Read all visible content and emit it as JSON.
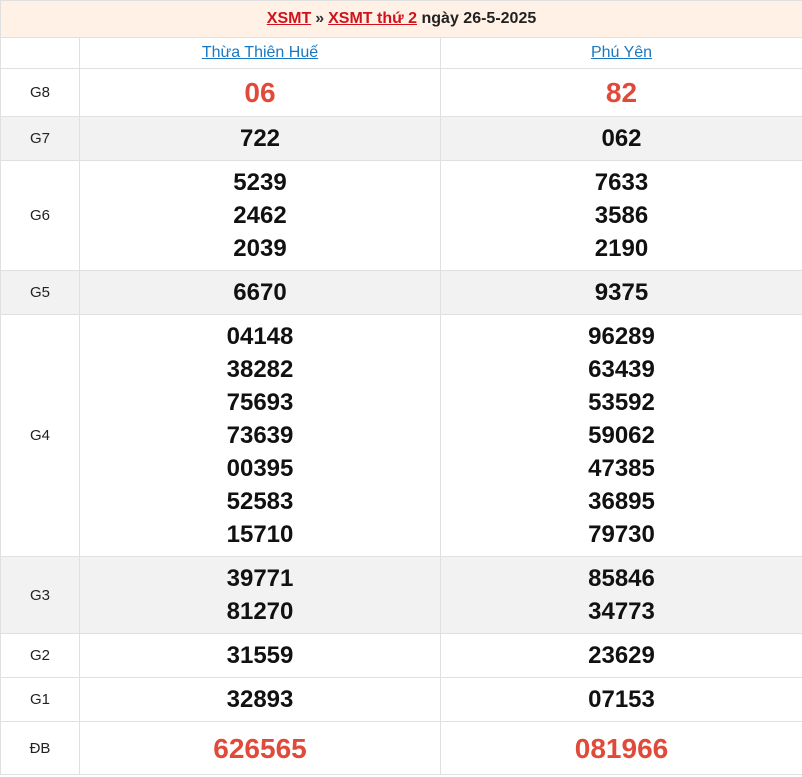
{
  "header": {
    "link1": "XSMT",
    "separator": "»",
    "link2": "XSMT thứ 2",
    "date_text": "ngày 26-5-2025"
  },
  "provinces": [
    "Thừa Thiên Huế",
    "Phú Yên"
  ],
  "prizes": [
    {
      "label": "G8",
      "p1": [
        "06"
      ],
      "p2": [
        "82"
      ]
    },
    {
      "label": "G7",
      "p1": [
        "722"
      ],
      "p2": [
        "062"
      ]
    },
    {
      "label": "G6",
      "p1": [
        "5239",
        "2462",
        "2039"
      ],
      "p2": [
        "7633",
        "3586",
        "2190"
      ]
    },
    {
      "label": "G5",
      "p1": [
        "6670"
      ],
      "p2": [
        "9375"
      ]
    },
    {
      "label": "G4",
      "p1": [
        "04148",
        "38282",
        "75693",
        "73639",
        "00395",
        "52583",
        "15710"
      ],
      "p2": [
        "96289",
        "63439",
        "53592",
        "59062",
        "47385",
        "36895",
        "79730"
      ]
    },
    {
      "label": "G3",
      "p1": [
        "39771",
        "81270"
      ],
      "p2": [
        "85846",
        "34773"
      ]
    },
    {
      "label": "G2",
      "p1": [
        "31559"
      ],
      "p2": [
        "23629"
      ]
    },
    {
      "label": "G1",
      "p1": [
        "32893"
      ],
      "p2": [
        "07153"
      ]
    },
    {
      "label": "ĐB",
      "p1": [
        "626565"
      ],
      "p2": [
        "081966"
      ]
    }
  ],
  "colors": {
    "title_link": "#d1121c",
    "province_link": "#1a78c2",
    "highlight_number": "#e04a3a",
    "title_background": "#fff1e6",
    "shaded_row": "#f2f2f2"
  }
}
